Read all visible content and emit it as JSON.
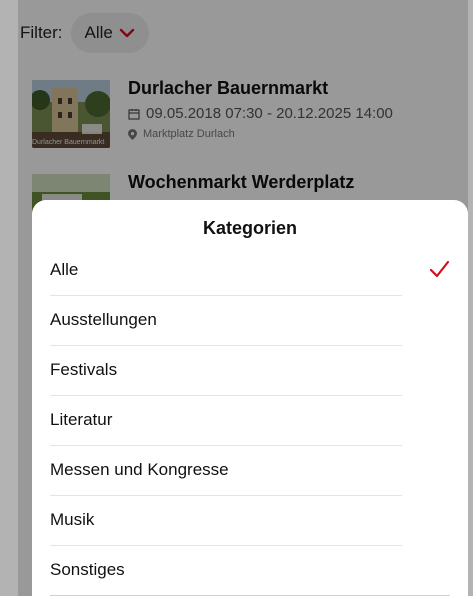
{
  "filter": {
    "label": "Filter:",
    "value": "Alle"
  },
  "events": [
    {
      "title": "Durlacher Bauernmarkt",
      "date": "09.05.2018 07:30 - 20.12.2025 14:00",
      "location": "Marktplatz Durlach",
      "thumb_caption": "Durlacher Bauernmarkt"
    },
    {
      "title": "Wochenmarkt Werderplatz"
    }
  ],
  "sheet": {
    "title": "Kategorien",
    "items": [
      "Alle",
      "Ausstellungen",
      "Festivals",
      "Literatur",
      "Messen und Kongresse",
      "Musik",
      "Sonstiges"
    ],
    "selected": "Alle"
  },
  "colors": {
    "accent": "#d0101f",
    "text": "#111111",
    "muted": "#777777"
  },
  "icons": {
    "calendar": "calendar-icon",
    "location": "location-pin-icon",
    "check": "checkmark-icon",
    "chevron": "chevron-down-icon"
  }
}
